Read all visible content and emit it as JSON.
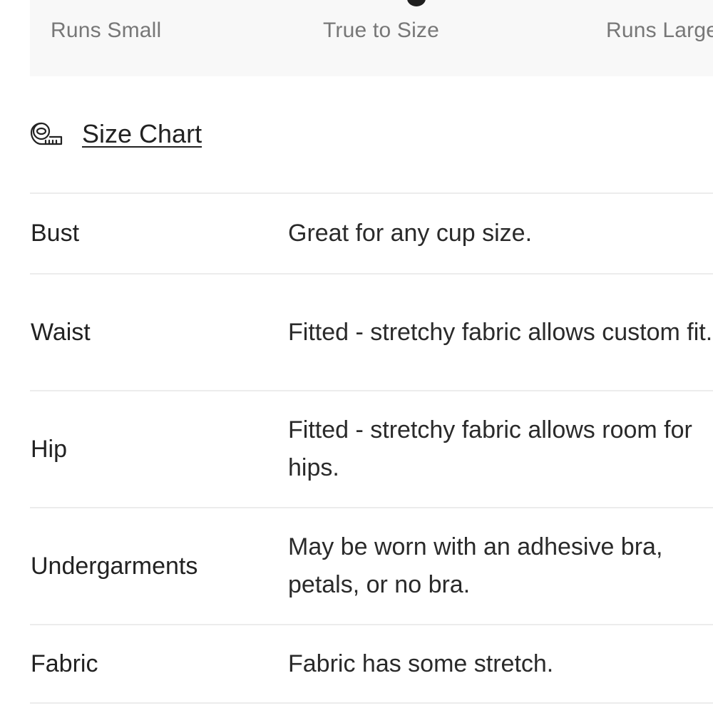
{
  "fit_scale": {
    "labels": [
      "Runs Small",
      "True to Size",
      "Runs Large"
    ],
    "selected": "True to Size"
  },
  "size_chart": {
    "label": "Size Chart",
    "icon": "measuring-tape-icon"
  },
  "fit_details": [
    {
      "term": "Bust",
      "description": "Great for any cup size."
    },
    {
      "term": "Waist",
      "description": "Fitted - stretchy fabric allows custom fit."
    },
    {
      "term": "Hip",
      "description": "Fitted - stretchy fabric allows room for hips."
    },
    {
      "term": "Undergarments",
      "description": "May be worn with an adhesive bra, petals, or no bra."
    },
    {
      "term": "Fabric",
      "description": "Fabric has some stretch."
    }
  ],
  "colors": {
    "panel_bg": "#f8f8f8",
    "divider": "#ececec",
    "text": "#222222",
    "muted_text": "#777777"
  }
}
